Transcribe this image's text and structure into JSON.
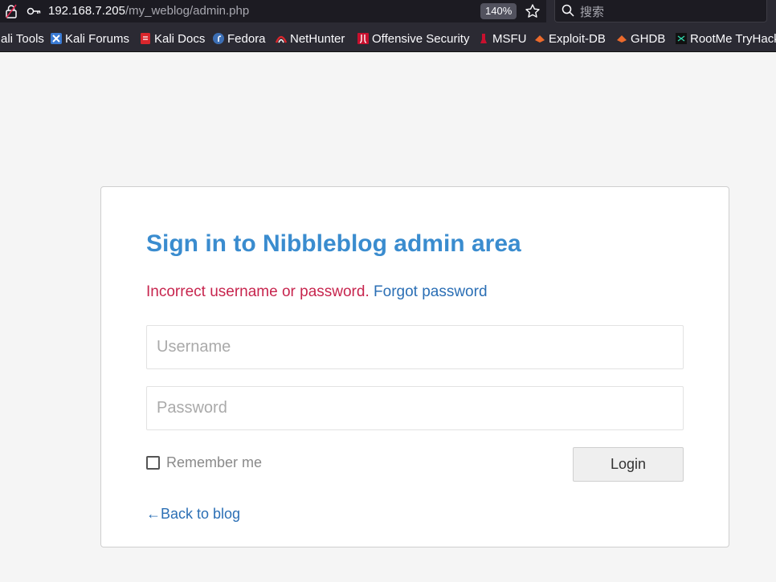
{
  "browser": {
    "url_host": "192.168.7.205",
    "url_path": "/my_weblog/admin.php",
    "zoom": "140%",
    "search_placeholder": "搜索"
  },
  "bookmarks": [
    {
      "label": "ali Tools",
      "icon": "kali-tools-icon"
    },
    {
      "label": "Kali Forums",
      "icon": "kali-forums-icon",
      "color": "#3a7bd5"
    },
    {
      "label": "Kali Docs",
      "icon": "kali-docs-icon",
      "color": "#d9262c"
    },
    {
      "label": "Fedora",
      "icon": "fedora-icon",
      "color": "#3c6eb4"
    },
    {
      "label": "NetHunter",
      "icon": "nethunter-icon",
      "color": "#d9262c"
    },
    {
      "label": "Offensive Security",
      "icon": "offsec-icon",
      "color": "#c8102e"
    },
    {
      "label": "MSFU",
      "icon": "msfu-icon",
      "color": "#c8102e"
    },
    {
      "label": "Exploit-DB",
      "icon": "exploit-db-icon",
      "color": "#ec6a2c"
    },
    {
      "label": "GHDB",
      "icon": "ghdb-icon",
      "color": "#ec6a2c"
    },
    {
      "label": "RootMe TryHack",
      "icon": "rootme-icon",
      "color": "#2fd3a8"
    }
  ],
  "page": {
    "title": "Sign in to Nibbleblog admin area",
    "error": "Incorrect username or password.",
    "forgot_link": "Forgot password",
    "username_placeholder": "Username",
    "password_placeholder": "Password",
    "remember_label": "Remember me",
    "login_label": "Login",
    "back_link": "←Back to blog"
  },
  "colors": {
    "title": "#3a8ccf",
    "error": "#c7254e",
    "link": "#2b6fb5"
  }
}
